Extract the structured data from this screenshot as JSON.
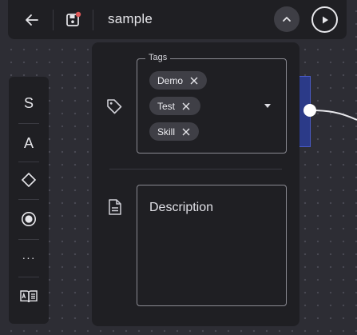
{
  "header": {
    "title": "sample",
    "back_icon": "arrow-left-icon",
    "save_icon": "save-icon",
    "collapse_icon": "chevron-up-icon",
    "run_icon": "play-icon",
    "unsaved_indicator_color": "#e05a5a"
  },
  "toolbar": {
    "items": [
      {
        "label": "S"
      },
      {
        "label": "A"
      },
      {
        "icon": "diamond-icon"
      },
      {
        "icon": "radio-target-icon"
      },
      {
        "label": "···"
      },
      {
        "icon": "book-ai-icon"
      }
    ]
  },
  "panel": {
    "tags": {
      "legend": "Tags",
      "chips": [
        "Demo",
        "Test",
        "Skill"
      ]
    },
    "description": {
      "placeholder": "Description"
    }
  },
  "colors": {
    "background": "#2d2d34",
    "surface": "#1f1f23",
    "chip": "#3f3f46",
    "node_accent": "#2b3a88"
  }
}
